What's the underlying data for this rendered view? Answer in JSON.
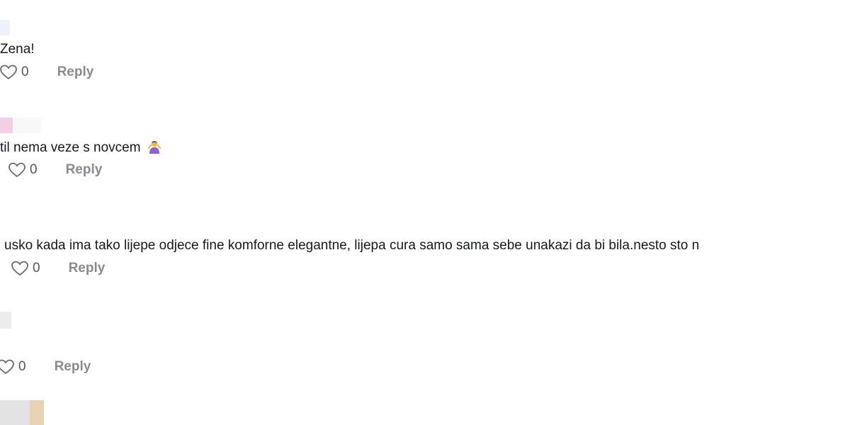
{
  "comments": [
    {
      "text": "Zena!",
      "likes": "0",
      "reply_label": "Reply",
      "avatar_colors": [
        "#eef2f8"
      ],
      "emoji": ""
    },
    {
      "text": "til nema veze s novcem",
      "likes": "0",
      "reply_label": "Reply",
      "avatar_colors": [
        "#f3cfe6",
        "#f8f8f8"
      ],
      "emoji": "person-gesturing-icon"
    },
    {
      "text": "usko kada ima tako lijepe odjece fine komforne elegantne, lijepa cura samo sama sebe unakazi da bi bila.nesto sto n",
      "likes": "0",
      "reply_label": "Reply",
      "avatar_colors": [],
      "emoji": ""
    },
    {
      "text": "",
      "likes": "0",
      "reply_label": "Reply",
      "avatar_colors": [
        "#ececee"
      ],
      "emoji": ""
    },
    {
      "text": "",
      "likes": "",
      "reply_label": "",
      "avatar_colors": [
        "#e3e3e3",
        "#e8d2b2"
      ],
      "emoji": ""
    }
  ],
  "colors": {
    "text": "#161823",
    "muted": "#8a8b91",
    "count": "#55575f",
    "heart_stroke": "#6a6b70"
  }
}
